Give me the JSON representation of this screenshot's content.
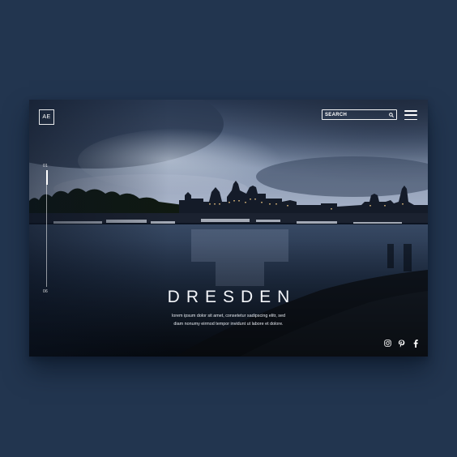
{
  "brand": {
    "logo_text": "AE"
  },
  "header": {
    "search_label": "SEARCH"
  },
  "slider": {
    "current": "01",
    "total": "06",
    "progress": 0.125
  },
  "hero": {
    "title": "DRESDEN",
    "description_line1": "lorem ipsum dolor sit amet, consetetur sadipscing elitr, sed",
    "description_line2": "diam nonumy eirmod tempor invidunt ut labore et dolore."
  },
  "social": {
    "icons": [
      "instagram-icon",
      "pinterest-icon",
      "facebook-icon"
    ]
  },
  "colors": {
    "page_background": "#22354f",
    "text": "#ffffff"
  }
}
